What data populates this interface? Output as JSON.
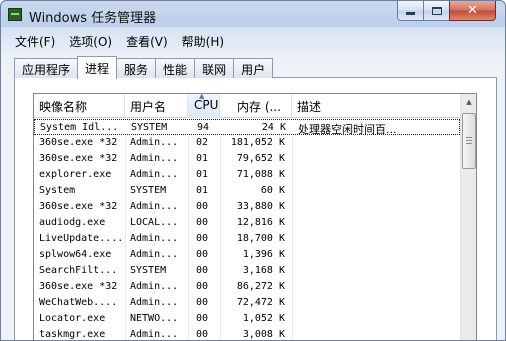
{
  "window": {
    "title": "Windows 任务管理器",
    "controls": {
      "close_glyph": "✕"
    }
  },
  "menu": [
    "文件(F)",
    "选项(O)",
    "查看(V)",
    "帮助(H)"
  ],
  "tabs": [
    {
      "label": "应用程序",
      "active": false
    },
    {
      "label": "进程",
      "active": true
    },
    {
      "label": "服务",
      "active": false
    },
    {
      "label": "性能",
      "active": false
    },
    {
      "label": "联网",
      "active": false
    },
    {
      "label": "用户",
      "active": false
    }
  ],
  "table": {
    "headers": {
      "name": "映像名称",
      "user": "用户名",
      "cpu": "CPU",
      "mem": "内存 (...",
      "desc": "描述"
    },
    "sort_arrow": "▲",
    "rows": [
      {
        "name": "System Idl...",
        "user": "SYSTEM",
        "cpu": "94",
        "mem": "24 K",
        "desc": "处理器空闲时间百...",
        "selected": true
      },
      {
        "name": "360se.exe *32",
        "user": "Admin...",
        "cpu": "02",
        "mem": "181,052 K",
        "desc": ""
      },
      {
        "name": "360se.exe *32",
        "user": "Admin...",
        "cpu": "01",
        "mem": "79,652 K",
        "desc": ""
      },
      {
        "name": "explorer.exe",
        "user": "Admin...",
        "cpu": "01",
        "mem": "71,088 K",
        "desc": ""
      },
      {
        "name": "System",
        "user": "SYSTEM",
        "cpu": "01",
        "mem": "60 K",
        "desc": ""
      },
      {
        "name": "360se.exe *32",
        "user": "Admin...",
        "cpu": "00",
        "mem": "33,880 K",
        "desc": ""
      },
      {
        "name": "audiodg.exe",
        "user": "LOCAL...",
        "cpu": "00",
        "mem": "12,816 K",
        "desc": ""
      },
      {
        "name": "LiveUpdate....",
        "user": "Admin...",
        "cpu": "00",
        "mem": "18,700 K",
        "desc": ""
      },
      {
        "name": "splwow64.exe",
        "user": "Admin...",
        "cpu": "00",
        "mem": "1,396 K",
        "desc": ""
      },
      {
        "name": "SearchFilt...",
        "user": "SYSTEM",
        "cpu": "00",
        "mem": "3,168 K",
        "desc": ""
      },
      {
        "name": "360se.exe *32",
        "user": "Admin...",
        "cpu": "00",
        "mem": "86,272 K",
        "desc": ""
      },
      {
        "name": "WeChatWeb....",
        "user": "Admin...",
        "cpu": "00",
        "mem": "72,472 K",
        "desc": ""
      },
      {
        "name": "Locator.exe",
        "user": "NETWO...",
        "cpu": "00",
        "mem": "1,052 K",
        "desc": ""
      },
      {
        "name": "taskmgr.exe",
        "user": "Admin...",
        "cpu": "00",
        "mem": "3,008 K",
        "desc": ""
      }
    ]
  },
  "scrollbar": {
    "up_glyph": "▲"
  }
}
